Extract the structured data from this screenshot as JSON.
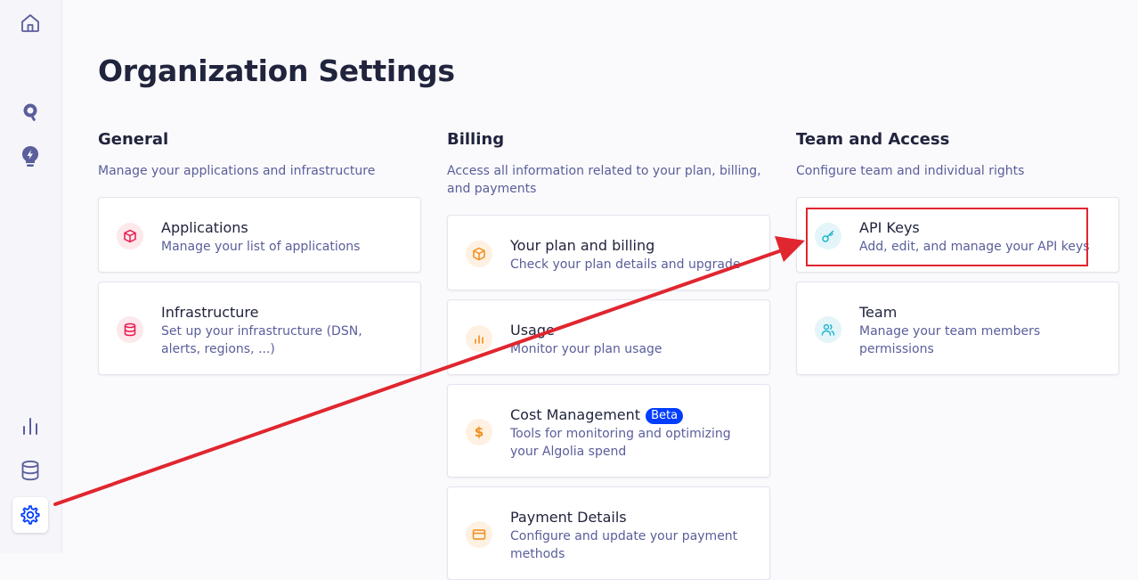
{
  "page": {
    "title": "Organization Settings"
  },
  "sidebar": {
    "items": [
      {
        "name": "home",
        "icon": "home-icon"
      },
      {
        "name": "search",
        "icon": "search-icon"
      },
      {
        "name": "bolt",
        "icon": "lightbulb-bolt-icon"
      },
      {
        "name": "analytics",
        "icon": "bar-chart-icon"
      },
      {
        "name": "data",
        "icon": "database-icon"
      },
      {
        "name": "settings",
        "icon": "gear-icon",
        "active": true
      }
    ]
  },
  "sections": {
    "general": {
      "title": "General",
      "description": "Manage your applications and infrastructure",
      "cards": [
        {
          "title": "Applications",
          "subtitle": "Manage your list of applications",
          "icon": "box-icon",
          "color": "#e8174d"
        },
        {
          "title": "Infrastructure",
          "subtitle": "Set up your infrastructure (DSN, alerts, regions, ...)",
          "icon": "database-icon",
          "color": "#e8174d"
        }
      ]
    },
    "billing": {
      "title": "Billing",
      "description": "Access all information related to your plan, billing, and payments",
      "cards": [
        {
          "title": "Your plan and billing",
          "subtitle": "Check your plan details and upgrade",
          "icon": "box-icon",
          "color": "#f18d1b"
        },
        {
          "title": "Usage",
          "subtitle": "Monitor your plan usage",
          "icon": "bar-chart-icon",
          "color": "#f18d1b"
        },
        {
          "title": "Cost Management",
          "badge": "Beta",
          "subtitle": "Tools for monitoring and optimizing your Algolia spend",
          "icon": "dollar-icon",
          "color": "#f18d1b"
        },
        {
          "title": "Payment Details",
          "subtitle": "Configure and update your payment methods",
          "icon": "credit-card-icon",
          "color": "#f18d1b"
        }
      ]
    },
    "team": {
      "title": "Team and Access",
      "description": "Configure team and individual rights",
      "cards": [
        {
          "title": "API Keys",
          "subtitle": "Add, edit, and manage your API keys",
          "icon": "key-icon",
          "color": "#1fb4cf"
        },
        {
          "title": "Team",
          "subtitle": "Manage your team members permissions",
          "icon": "users-icon",
          "color": "#1fb4cf"
        }
      ]
    }
  },
  "colors": {
    "accent": "#003dff",
    "annotation": "#e0262f",
    "general_icon_bg": "#fde8ec",
    "billing_icon_bg": "#fef1e2",
    "team_icon_bg": "#e3f5f9"
  }
}
